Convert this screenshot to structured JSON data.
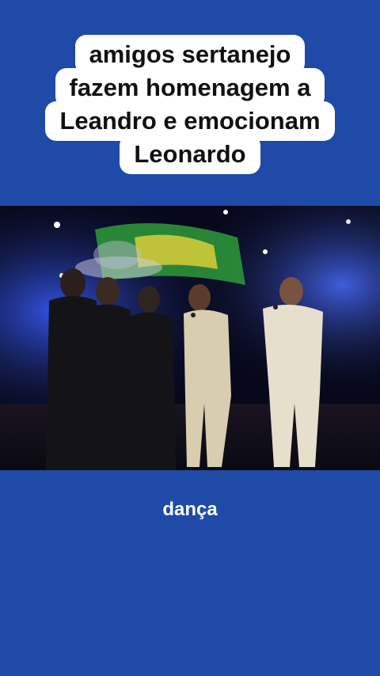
{
  "caption": {
    "lines": [
      "amigos sertanejo",
      "fazem homenagem a",
      "Leandro e emocionam",
      "Leonardo"
    ]
  },
  "video": {
    "description_icon": "concert-stage-scene"
  },
  "subtitle": {
    "text": "dança"
  },
  "colors": {
    "background": "#1f4aa8",
    "caption_bg": "#ffffff",
    "caption_text": "#111111",
    "subtitle_text": "#ffffff"
  }
}
